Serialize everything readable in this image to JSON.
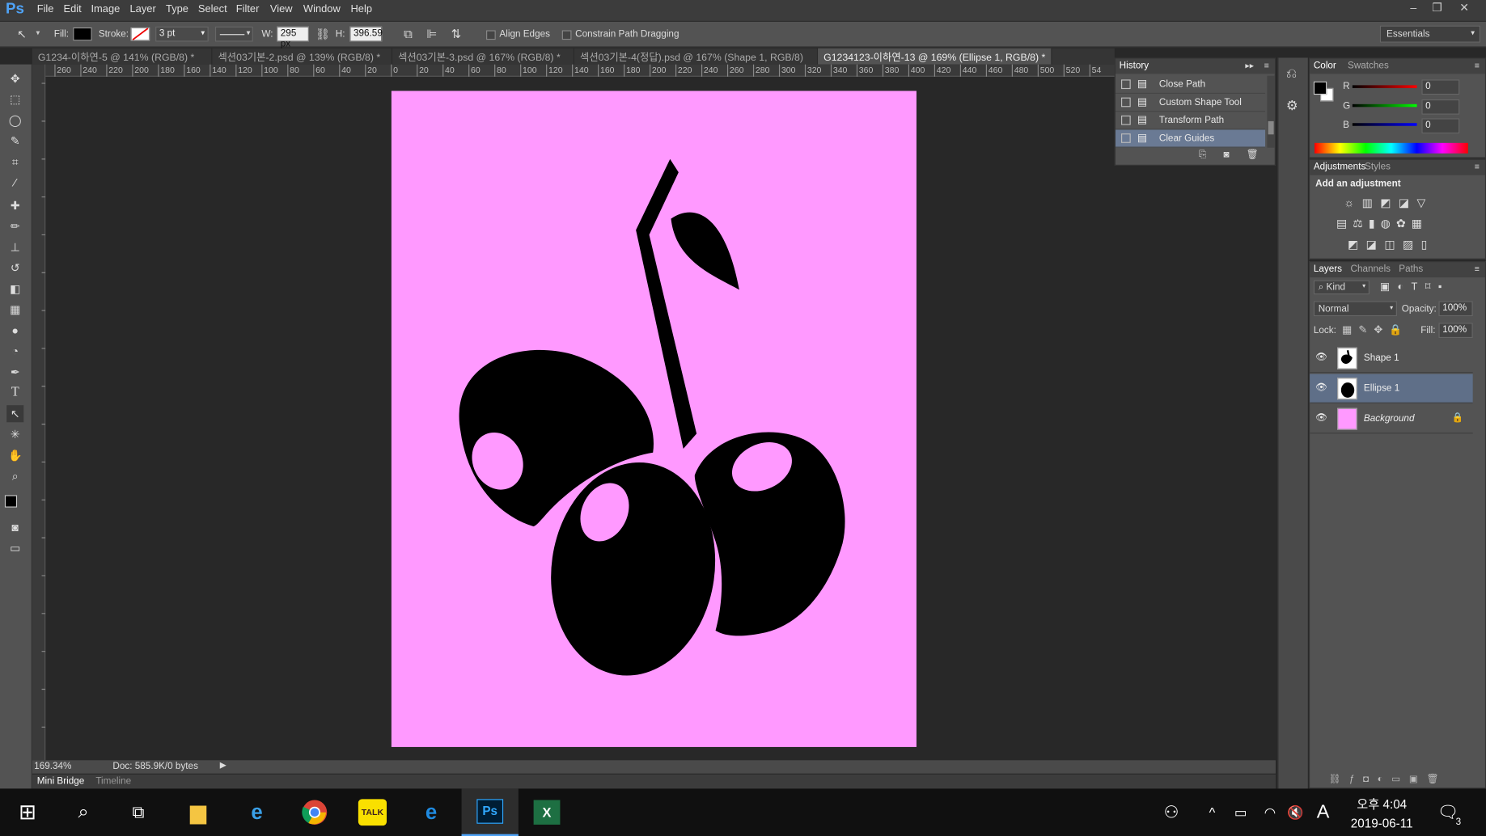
{
  "app": {
    "logo": "Ps"
  },
  "menu": [
    "File",
    "Edit",
    "Image",
    "Layer",
    "Type",
    "Select",
    "Filter",
    "View",
    "Window",
    "Help"
  ],
  "options": {
    "fill_label": "Fill:",
    "stroke_label": "Stroke:",
    "stroke_size": "3 pt",
    "w_label": "W:",
    "w_value": "295 px",
    "h_label": "H:",
    "h_value": "396.59",
    "align_edges": "Align Edges",
    "constrain": "Constrain Path Dragging",
    "workspace": "Essentials"
  },
  "tabs": [
    {
      "label": "G1234-이하연-5 @ 141% (RGB/8) *"
    },
    {
      "label": "섹션03기본-2.psd @ 139% (RGB/8) *"
    },
    {
      "label": "섹션03기본-3.psd @ 167% (RGB/8) *"
    },
    {
      "label": "섹션03기본-4(정답).psd @ 167% (Shape 1, RGB/8)"
    },
    {
      "label": "G1234123-이하연-13 @ 169% (Ellipse 1, RGB/8) *"
    }
  ],
  "ruler_h": [
    "260",
    "240",
    "220",
    "200",
    "180",
    "160",
    "140",
    "120",
    "100",
    "80",
    "60",
    "40",
    "20",
    "0",
    "20",
    "40",
    "60",
    "80",
    "100",
    "120",
    "140",
    "160",
    "180",
    "200",
    "220",
    "240",
    "260",
    "280",
    "300",
    "320",
    "340",
    "360",
    "380",
    "400",
    "420",
    "440",
    "460",
    "480",
    "500",
    "520",
    "54"
  ],
  "canvas": {
    "background": "#ff99ff"
  },
  "status": {
    "zoom": "169.34%",
    "doc": "Doc: 585.9K/0 bytes"
  },
  "bottom_tabs": [
    "Mini Bridge",
    "Timeline"
  ],
  "history": {
    "title": "History",
    "items": [
      "Close Path",
      "Custom Shape Tool",
      "Transform Path",
      "Clear Guides"
    ]
  },
  "color": {
    "tabs": [
      "Color",
      "Swatches"
    ],
    "r_label": "R",
    "g_label": "G",
    "b_label": "B",
    "r": "0",
    "g": "0",
    "b": "0"
  },
  "adjustments": {
    "tabs": [
      "Adjustments",
      "Styles"
    ],
    "add_label": "Add an adjustment"
  },
  "layers": {
    "tabs": [
      "Layers",
      "Channels",
      "Paths"
    ],
    "kind": "Kind",
    "blend": "Normal",
    "opacity_label": "Opacity:",
    "opacity": "100%",
    "lock_label": "Lock:",
    "fill_label": "Fill:",
    "fill": "100%",
    "items": [
      {
        "name": "Shape 1"
      },
      {
        "name": "Ellipse 1"
      },
      {
        "name": "Background"
      }
    ]
  },
  "taskbar": {
    "time_prefix": "오후",
    "time": "4:04",
    "date": "2019-06-11",
    "ime": "A",
    "notif": "3",
    "kakao": "TALK"
  }
}
